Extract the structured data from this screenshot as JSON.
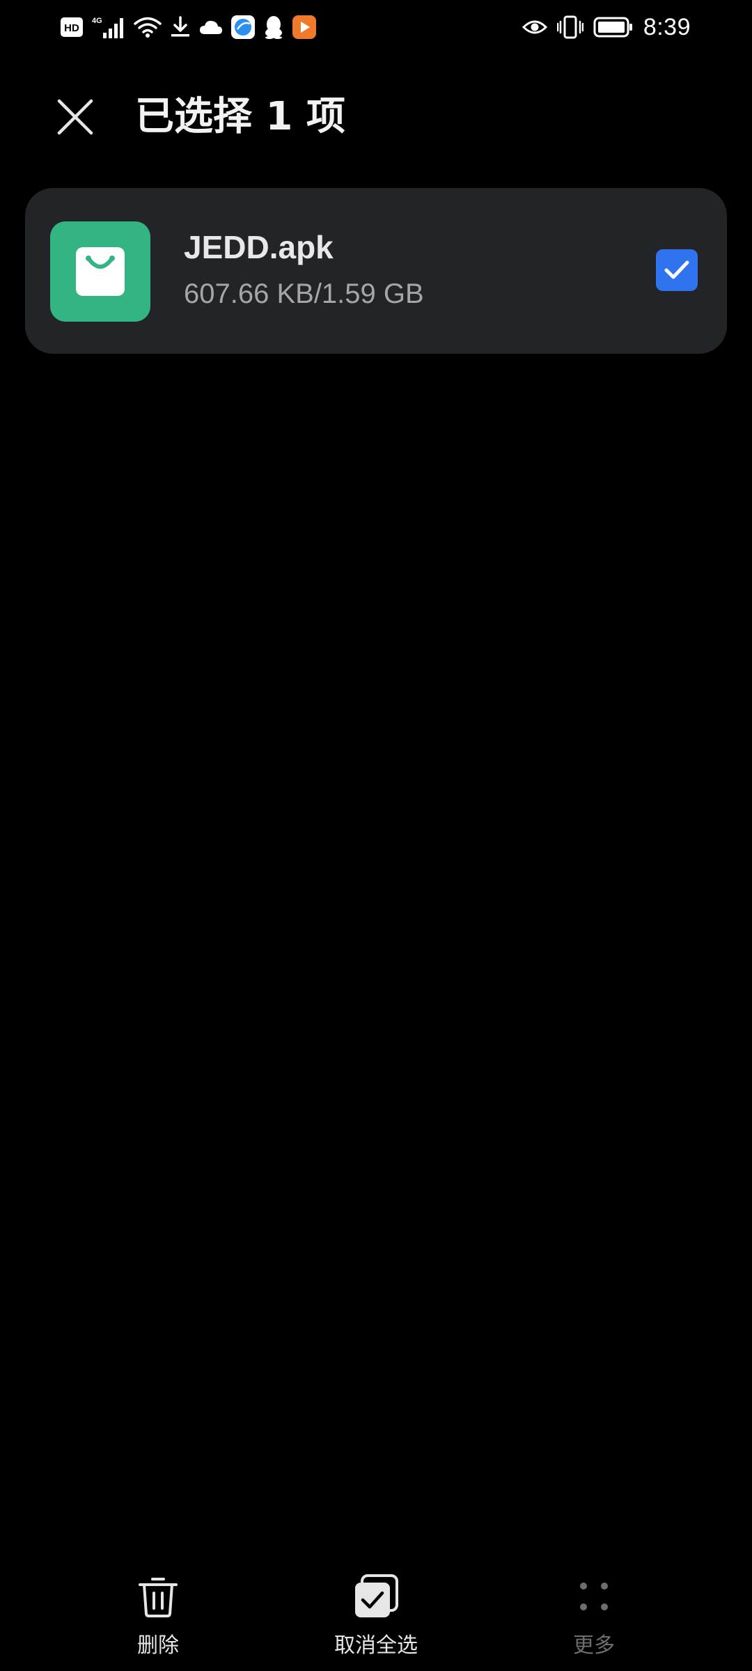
{
  "status_bar": {
    "hd_label": "HD",
    "network_label": "4G",
    "time": "8:39",
    "left_icons": [
      "hd-icon",
      "signal-4g-icon",
      "wifi-icon",
      "download-icon",
      "cloud-icon",
      "browser-app-icon",
      "qq-icon",
      "video-app-icon"
    ],
    "right_icons": [
      "eye-comfort-icon",
      "vibrate-icon",
      "battery-icon"
    ]
  },
  "header": {
    "title": "已选择 1 项",
    "close_icon": "close-icon"
  },
  "file_list": [
    {
      "name": "JEDD.apk",
      "size": "607.66 KB/1.59 GB",
      "icon": "apk-shopping-bag-icon",
      "checked": true
    }
  ],
  "toolbar": {
    "delete_label": "删除",
    "deselect_all_label": "取消全选",
    "more_label": "更多",
    "more_disabled": true
  },
  "colors": {
    "background": "#000000",
    "card": "#232427",
    "accent": "#2f74ee",
    "apk_icon": "#33b583"
  }
}
